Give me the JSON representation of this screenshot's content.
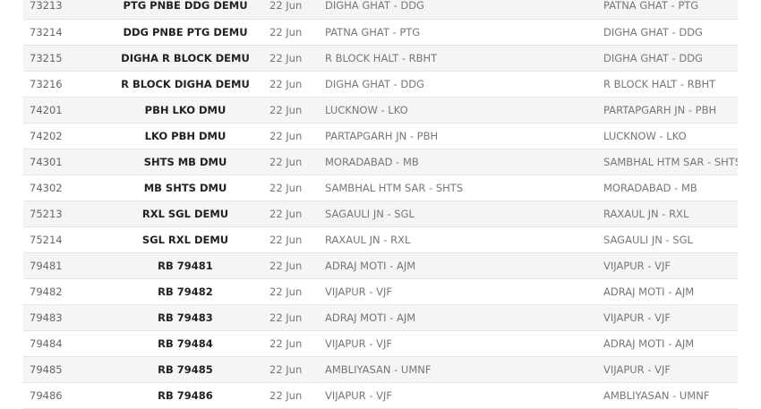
{
  "trains": [
    {
      "number": "73213",
      "name": "PTG PNBE DDG DEMU",
      "date": "22 Jun",
      "from": "DIGHA GHAT - DDG",
      "to": "PATNA GHAT - PTG"
    },
    {
      "number": "73214",
      "name": "DDG PNBE PTG DEMU",
      "date": "22 Jun",
      "from": "PATNA GHAT - PTG",
      "to": "DIGHA GHAT - DDG"
    },
    {
      "number": "73215",
      "name": "DIGHA R BLOCK DEMU",
      "date": "22 Jun",
      "from": "R BLOCK HALT - RBHT",
      "to": "DIGHA GHAT - DDG"
    },
    {
      "number": "73216",
      "name": "R BLOCK DIGHA DEMU",
      "date": "22 Jun",
      "from": "DIGHA GHAT - DDG",
      "to": "R BLOCK HALT - RBHT"
    },
    {
      "number": "74201",
      "name": "PBH LKO DMU",
      "date": "22 Jun",
      "from": "LUCKNOW - LKO",
      "to": "PARTAPGARH JN - PBH"
    },
    {
      "number": "74202",
      "name": "LKO PBH DMU",
      "date": "22 Jun",
      "from": "PARTAPGARH JN - PBH",
      "to": "LUCKNOW - LKO"
    },
    {
      "number": "74301",
      "name": "SHTS MB DMU",
      "date": "22 Jun",
      "from": "MORADABAD - MB",
      "to": "SAMBHAL HTM SAR - SHTS"
    },
    {
      "number": "74302",
      "name": "MB SHTS DMU",
      "date": "22 Jun",
      "from": "SAMBHAL HTM SAR - SHTS",
      "to": "MORADABAD - MB"
    },
    {
      "number": "75213",
      "name": "RXL SGL DEMU",
      "date": "22 Jun",
      "from": "SAGAULI JN - SGL",
      "to": "RAXAUL JN - RXL"
    },
    {
      "number": "75214",
      "name": "SGL RXL DEMU",
      "date": "22 Jun",
      "from": "RAXAUL JN - RXL",
      "to": "SAGAULI JN - SGL"
    },
    {
      "number": "79481",
      "name": "RB 79481",
      "date": "22 Jun",
      "from": "ADRAJ MOTI - AJM",
      "to": "VIJAPUR - VJF"
    },
    {
      "number": "79482",
      "name": "RB 79482",
      "date": "22 Jun",
      "from": "VIJAPUR - VJF",
      "to": "ADRAJ MOTI - AJM"
    },
    {
      "number": "79483",
      "name": "RB 79483",
      "date": "22 Jun",
      "from": "ADRAJ MOTI - AJM",
      "to": "VIJAPUR - VJF"
    },
    {
      "number": "79484",
      "name": "RB 79484",
      "date": "22 Jun",
      "from": "VIJAPUR - VJF",
      "to": "ADRAJ MOTI - AJM"
    },
    {
      "number": "79485",
      "name": "RB 79485",
      "date": "22 Jun",
      "from": "AMBLIYASAN - UMNF",
      "to": "VIJAPUR - VJF"
    },
    {
      "number": "79486",
      "name": "RB 79486",
      "date": "22 Jun",
      "from": "VIJAPUR - VJF",
      "to": "AMBLIYASAN - UMNF"
    }
  ]
}
